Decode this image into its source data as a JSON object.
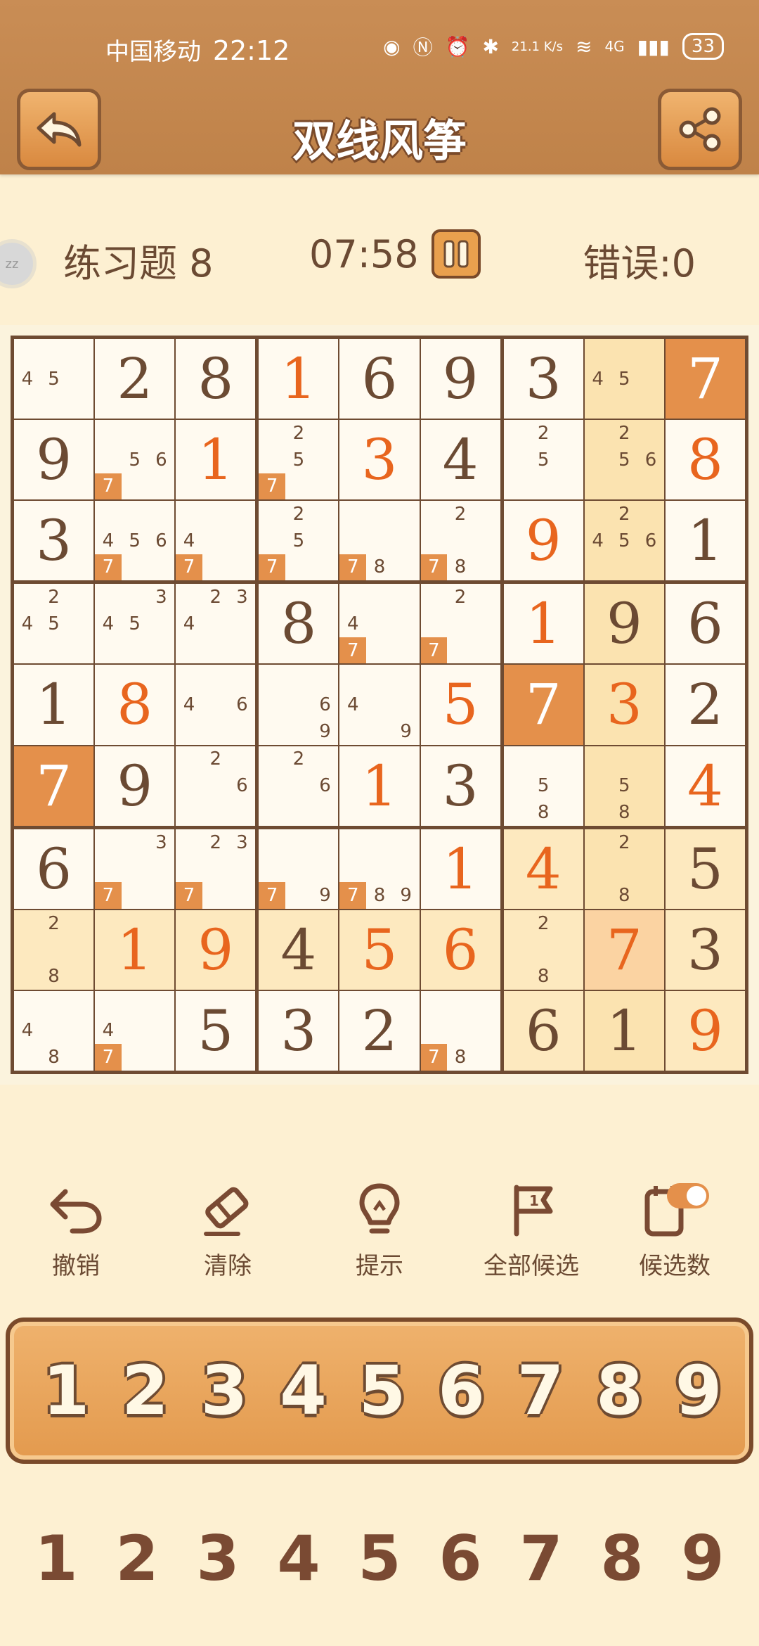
{
  "status_bar": {
    "carrier": "中国移动",
    "time": "22:12",
    "network_speed": "21.1 K/s",
    "network_type": "4G",
    "battery": "33"
  },
  "header": {
    "title": "双线风筝",
    "back_icon": "back-arrow-icon",
    "share_icon": "share-icon"
  },
  "info": {
    "level": "练习题 8",
    "timer": "07:58",
    "errors": "错误:0"
  },
  "board": {
    "grid": [
      [
        0,
        2,
        8,
        1,
        6,
        9,
        3,
        0,
        7
      ],
      [
        9,
        0,
        1,
        0,
        3,
        4,
        0,
        0,
        8
      ],
      [
        3,
        0,
        0,
        0,
        0,
        0,
        9,
        0,
        1
      ],
      [
        0,
        0,
        0,
        8,
        0,
        0,
        1,
        9,
        6
      ],
      [
        1,
        8,
        0,
        0,
        0,
        5,
        7,
        3,
        2
      ],
      [
        7,
        9,
        0,
        0,
        1,
        3,
        0,
        0,
        4
      ],
      [
        6,
        0,
        0,
        0,
        0,
        1,
        4,
        0,
        5
      ],
      [
        0,
        1,
        9,
        4,
        5,
        6,
        0,
        7,
        3
      ],
      [
        0,
        0,
        5,
        3,
        2,
        0,
        6,
        1,
        9
      ]
    ],
    "user_entered": [
      [
        0,
        3
      ],
      [
        0,
        8
      ],
      [
        1,
        2
      ],
      [
        1,
        4
      ],
      [
        1,
        8
      ],
      [
        2,
        6
      ],
      [
        3,
        6
      ],
      [
        4,
        1
      ],
      [
        4,
        5
      ],
      [
        4,
        6
      ],
      [
        4,
        7
      ],
      [
        5,
        0
      ],
      [
        5,
        4
      ],
      [
        5,
        8
      ],
      [
        6,
        5
      ],
      [
        6,
        6
      ],
      [
        7,
        1
      ],
      [
        7,
        2
      ],
      [
        7,
        4
      ],
      [
        7,
        5
      ],
      [
        7,
        7
      ],
      [
        8,
        8
      ]
    ],
    "candidates": {
      "0,0": [
        4,
        5
      ],
      "0,7": [
        4,
        5
      ],
      "1,1": [
        5,
        6,
        7
      ],
      "1,3": [
        2,
        5,
        7
      ],
      "1,6": [
        2,
        5
      ],
      "1,7": [
        2,
        5,
        6
      ],
      "2,1": [
        4,
        5,
        6,
        7
      ],
      "2,2": [
        4,
        7
      ],
      "2,3": [
        2,
        5,
        7
      ],
      "2,4": [
        7,
        8
      ],
      "2,5": [
        2,
        7,
        8
      ],
      "2,7": [
        2,
        4,
        5,
        6
      ],
      "3,0": [
        2,
        4,
        5
      ],
      "3,1": [
        3,
        4,
        5
      ],
      "3,2": [
        2,
        3,
        4
      ],
      "3,4": [
        4,
        7
      ],
      "3,5": [
        2,
        7
      ],
      "4,2": [
        4,
        6
      ],
      "4,3": [
        6,
        9
      ],
      "4,4": [
        4,
        9
      ],
      "5,2": [
        2,
        6
      ],
      "5,3": [
        2,
        6
      ],
      "5,6": [
        5,
        8
      ],
      "5,7": [
        5,
        8
      ],
      "6,1": [
        3,
        7
      ],
      "6,2": [
        2,
        3,
        7
      ],
      "6,3": [
        7,
        9
      ],
      "6,4": [
        7,
        8,
        9
      ],
      "6,7": [
        2,
        8
      ],
      "7,0": [
        2,
        8
      ],
      "7,6": [
        2,
        8
      ],
      "8,0": [
        4,
        8
      ],
      "8,1": [
        4,
        7
      ],
      "8,5": [
        7,
        8
      ]
    },
    "marked_candidate": 7
  },
  "tools": [
    {
      "label": "撤销",
      "icon": "undo-icon"
    },
    {
      "label": "清除",
      "icon": "eraser-icon"
    },
    {
      "label": "提示",
      "icon": "lightbulb-icon"
    },
    {
      "label": "全部候选",
      "icon": "flag-icon"
    },
    {
      "label": "候选数",
      "icon": "notes-toggle-icon"
    }
  ],
  "number_pad": [
    "1",
    "2",
    "3",
    "4",
    "5",
    "6",
    "7",
    "8",
    "9"
  ],
  "candidate_pad": [
    "1",
    "2",
    "3",
    "4",
    "5",
    "6",
    "7",
    "8",
    "9"
  ]
}
